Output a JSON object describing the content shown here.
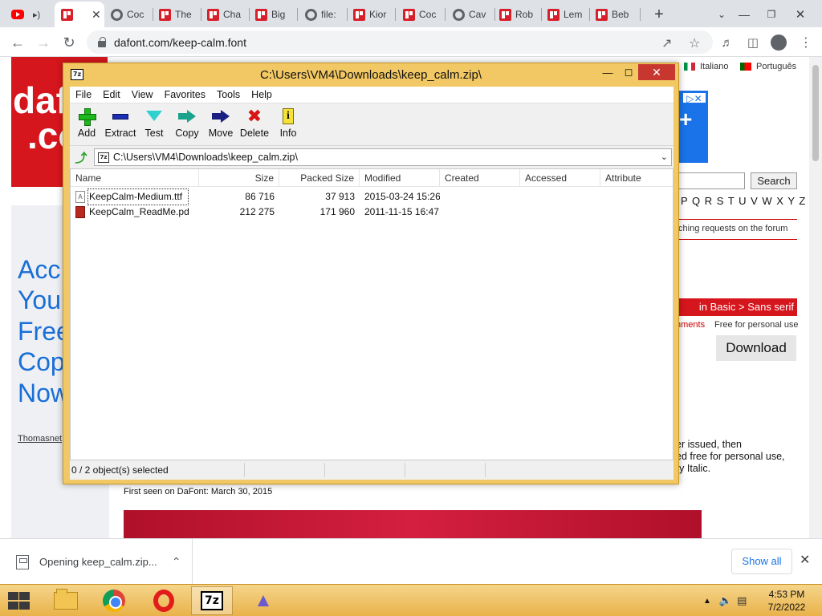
{
  "browser": {
    "tabs": [
      {
        "label": "",
        "icon": "youtube"
      },
      {
        "label": "",
        "icon": "dafont",
        "active": true
      },
      {
        "label": "Coc",
        "icon": "globe"
      },
      {
        "label": "The",
        "icon": "dafont"
      },
      {
        "label": "Cha",
        "icon": "dafont"
      },
      {
        "label": "Big",
        "icon": "dafont"
      },
      {
        "label": "file:",
        "icon": "globe"
      },
      {
        "label": "Kior",
        "icon": "dafont"
      },
      {
        "label": "Coc",
        "icon": "dafont"
      },
      {
        "label": "Cav",
        "icon": "globe"
      },
      {
        "label": "Rob",
        "icon": "dafont"
      },
      {
        "label": "Lem",
        "icon": "dafont"
      },
      {
        "label": "Beb",
        "icon": "dafont"
      }
    ],
    "url": "dafont.com/keep-calm.font"
  },
  "page": {
    "logo_top": "daf",
    "logo_bottom": ".co",
    "lang_it": "Italiano",
    "lang_pt": "Português",
    "left_ad_lines": [
      "Acc",
      "Your",
      "Free",
      "Cop",
      "Now"
    ],
    "thomasnet": "Thomasnet",
    "search_button": "Search",
    "alphabet": "P Q R S T U V W X Y Z #",
    "forum_text": "tching requests on the forum",
    "category": "in Basic > Sans serif",
    "comments": "nments",
    "free_use": "Free for personal use",
    "download": "Download",
    "desc_lines": [
      "er issued, then",
      "ed free for personal use,",
      "ry Italic."
    ],
    "first_seen": "First seen on DaFont: March 30, 2015"
  },
  "download_bar": {
    "item_label": "Opening keep_calm.zip...",
    "show_all": "Show all"
  },
  "taskbar": {
    "time": "4:53 PM",
    "date": "7/2/2022"
  },
  "sevenzip": {
    "title": "C:\\Users\\VM4\\Downloads\\keep_calm.zip\\",
    "app_icon": "7z",
    "menu": [
      "File",
      "Edit",
      "View",
      "Favorites",
      "Tools",
      "Help"
    ],
    "tools": [
      "Add",
      "Extract",
      "Test",
      "Copy",
      "Move",
      "Delete",
      "Info"
    ],
    "path": "C:\\Users\\VM4\\Downloads\\keep_calm.zip\\",
    "columns": [
      "Name",
      "Size",
      "Packed Size",
      "Modified",
      "Created",
      "Accessed",
      "Attribute"
    ],
    "files": [
      {
        "name": "KeepCalm-Medium.ttf",
        "size": "86 716",
        "packed": "37 913",
        "modified": "2015-03-24 15:26",
        "type": "ttf"
      },
      {
        "name": "KeepCalm_ReadMe.pdf",
        "size": "212 275",
        "packed": "171 960",
        "modified": "2011-11-15 16:47",
        "type": "pdf"
      }
    ],
    "status": "0 / 2 object(s) selected"
  }
}
